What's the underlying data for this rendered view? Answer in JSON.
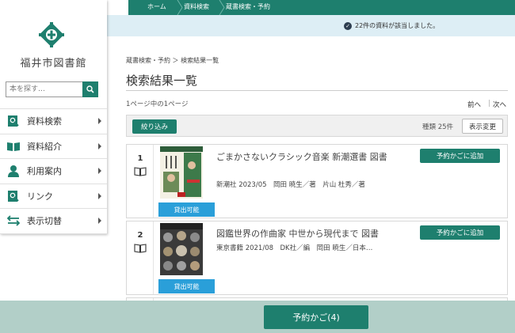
{
  "colors": {
    "accent": "#1e7f6e",
    "available": "#2a9fd9",
    "notice_bg": "#ddeef5",
    "bottom_bar": "#b2cfc8"
  },
  "sidebar": {
    "library_name": "福井市図書館",
    "search_placeholder": "本を探す…",
    "items": [
      {
        "label": "資料検索",
        "icon": "book-search-icon"
      },
      {
        "label": "資料紹介",
        "icon": "open-book-icon"
      },
      {
        "label": "利用案内",
        "icon": "user-icon"
      },
      {
        "label": "リンク",
        "icon": "link-search-icon"
      },
      {
        "label": "表示切替",
        "icon": "switch-arrows-icon"
      }
    ]
  },
  "breadcrumb": [
    "ホーム",
    "資料検索",
    "蔵書検索・予約"
  ],
  "notice": "22件の資料が該当しました。",
  "main": {
    "crumb": "蔵書検索・予約 ＞ 検索結果一覧",
    "title": "検索結果一覧",
    "page_info": "1ページ中の1ページ",
    "prev": "前へ",
    "divider": "|",
    "next": "次へ",
    "filter_label": "絞り込み",
    "count_label": "種類 25件",
    "display_label": "表示変更"
  },
  "results": [
    {
      "num": "1",
      "title": "ごまかさないクラシック音楽 新潮選書 図書",
      "meta": "新潮社 2023/05　岡田 暁生／著　片山 杜秀／著",
      "status": "貸出可能",
      "add_label": "予約かごに追加"
    },
    {
      "num": "2",
      "title": "図鑑世界の作曲家 中世から現代まで 図書",
      "meta": "東京書籍 2021/08　DK社／編　岡田 暁生／日本…",
      "status": "貸出可能",
      "add_label": "予約かごに追加"
    }
  ],
  "cart": {
    "label": "予約かご(4)"
  }
}
